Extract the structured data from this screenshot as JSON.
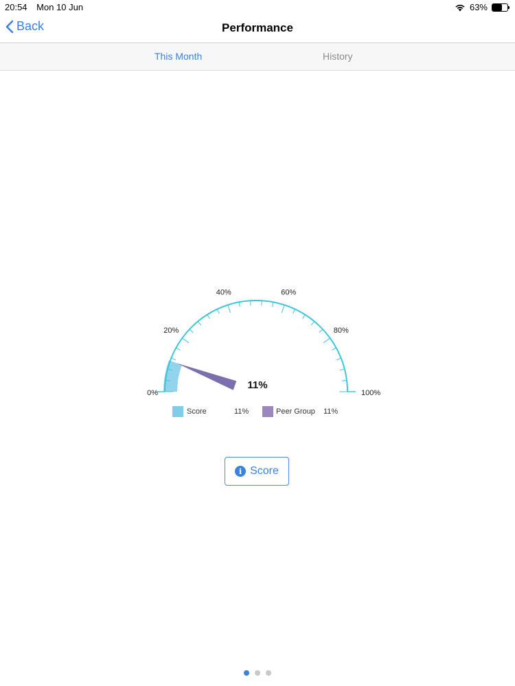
{
  "status_bar": {
    "time": "20:54",
    "date": "Mon 10 Jun",
    "battery": "63%",
    "battery_level": 0.63
  },
  "nav": {
    "back_label": "Back",
    "title": "Performance"
  },
  "segments": {
    "this_month": "This Month",
    "history": "History",
    "selected": "This Month"
  },
  "gauge": {
    "center_value_label": "11%",
    "legend": [
      {
        "name": "Score",
        "value_label": "11%",
        "color": "#7fcde8"
      },
      {
        "name": "Peer Group",
        "value_label": "11%",
        "color": "#9b86be"
      }
    ]
  },
  "chart_data": {
    "type": "gauge",
    "min": 0,
    "max": 100,
    "tick_labels": [
      "0%",
      "20%",
      "40%",
      "60%",
      "80%",
      "100%"
    ],
    "major_ticks": [
      0,
      20,
      40,
      60,
      80,
      100
    ],
    "minor_step": 4,
    "series": [
      {
        "name": "Score",
        "value": 11,
        "style": "band",
        "color": "#7fcde8"
      },
      {
        "name": "Peer Group",
        "value": 11,
        "style": "needle",
        "color": "#7d6fad"
      }
    ],
    "arc_color": "#3cc6d8"
  },
  "buttons": {
    "score_label": "Score"
  },
  "pager": {
    "count": 3,
    "active_index": 0
  },
  "colors": {
    "accent": "#3a82e0",
    "inactive_tab": "#8a8a8a"
  }
}
